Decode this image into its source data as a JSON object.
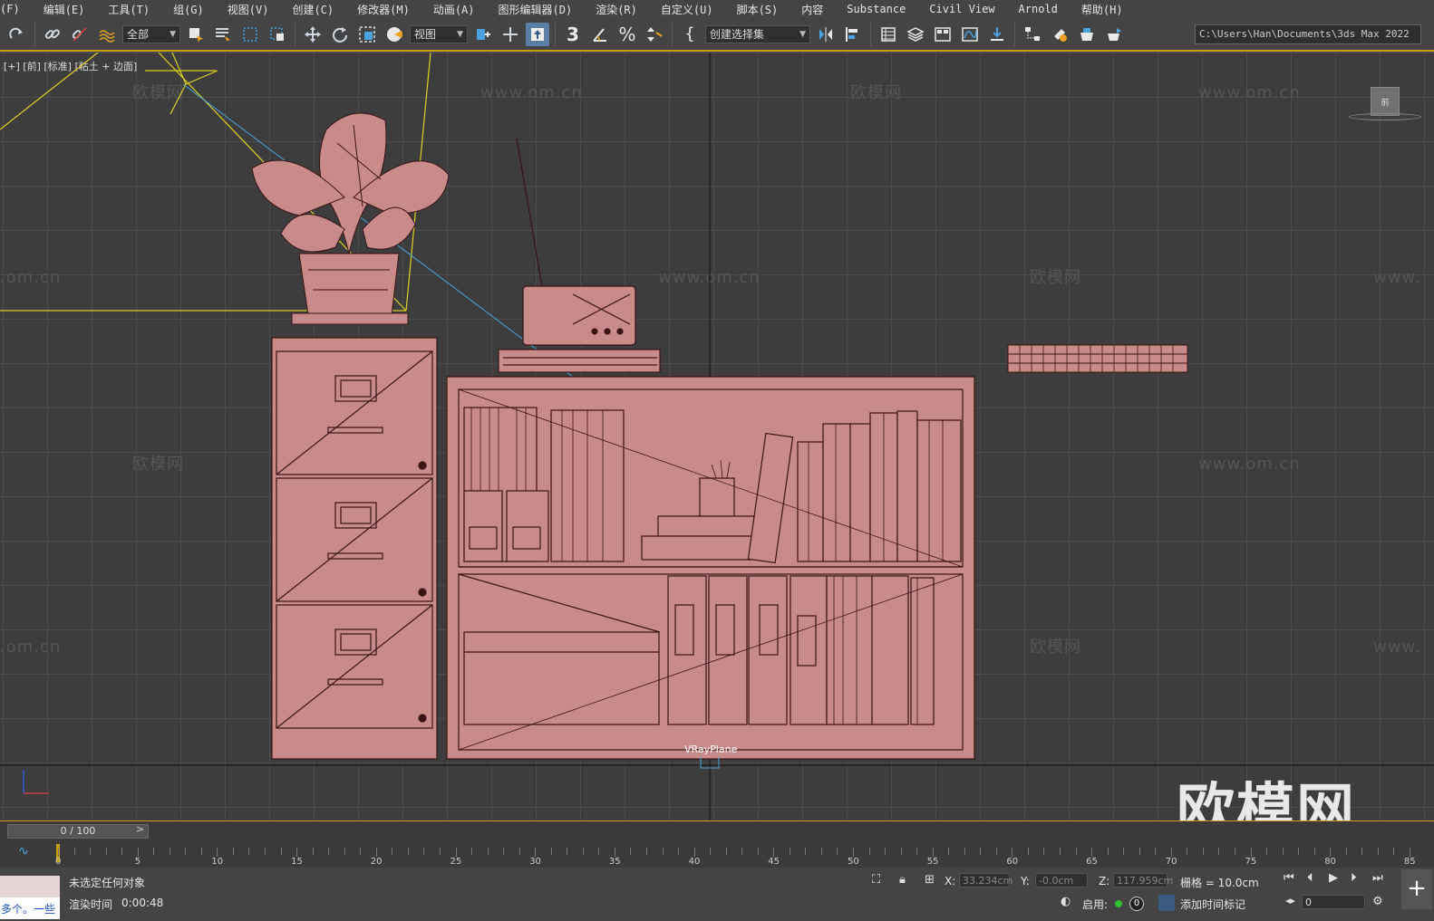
{
  "menu": {
    "items": [
      "(F)",
      "编辑(E)",
      "工具(T)",
      "组(G)",
      "视图(V)",
      "创建(C)",
      "修改器(M)",
      "动画(A)",
      "图形编辑器(D)",
      "渲染(R)",
      "自定义(U)",
      "脚本(S)",
      "内容",
      "Substance",
      "Civil View",
      "Arnold",
      "帮助(H)"
    ]
  },
  "toolbar": {
    "selection_filter": "全部",
    "reference_coord": "视图",
    "named_selection": "创建选择集",
    "snap_label": "3",
    "project_path": "C:\\Users\\Han\\Documents\\3ds Max 2022"
  },
  "viewport": {
    "label": "[+] [前] [标准] [粘土 + 边面]",
    "vray_plane_label": "VRayPlane",
    "viewcube_face": "前",
    "watermark_url": "www.om.cn",
    "watermark_cn": "欧模网",
    "watermark_url_partial": ".om.cn",
    "watermark_url_partial2": "www.",
    "brand": "欧模网"
  },
  "timeline": {
    "frame_display": "0 / 100",
    "ticks": [
      "0",
      "5",
      "10",
      "15",
      "20",
      "25",
      "30",
      "35",
      "40",
      "45",
      "50",
      "55",
      "60",
      "65",
      "70",
      "75",
      "80",
      "85"
    ]
  },
  "status": {
    "script_text": "多个。一些",
    "selection_status": "未选定任何对象",
    "render_time_label": "渲染时间",
    "render_time_value": "0:00:48",
    "x_label": "X:",
    "x_value": "33.234cm",
    "y_label": "Y:",
    "y_value": "-0.0cm",
    "z_label": "Z:",
    "z_value": "117.959cm",
    "grid_text": "栅格 = 10.0cm",
    "enable_label": "启用:",
    "enable_count": "0",
    "add_time_tag": "添加时间标记",
    "frame_input": "0"
  },
  "colors": {
    "object": "#c98a8a",
    "wire": "#3a1414",
    "camera": "#e0d020",
    "target_line": "#4aa3df",
    "timeline_accent": "#c8a000"
  }
}
